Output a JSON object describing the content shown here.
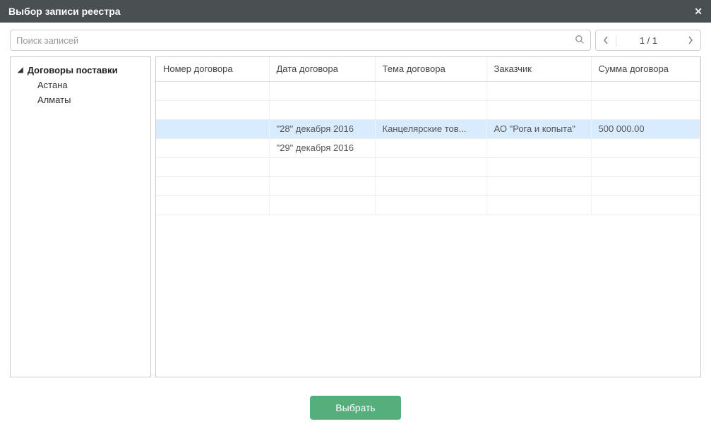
{
  "dialog": {
    "title": "Выбор записи реестра"
  },
  "search": {
    "placeholder": "Поиск записей"
  },
  "pagination": {
    "display": "1 / 1"
  },
  "sidebar": {
    "root": "Договоры поставки",
    "children": [
      "Астана",
      "Алматы"
    ]
  },
  "columns": [
    "Номер договора",
    "Дата договора",
    "Тема договора",
    "Заказчик",
    "Сумма договора"
  ],
  "rows": [
    {
      "number": "",
      "date": "",
      "topic": "",
      "customer": "",
      "amount": "",
      "selected": false
    },
    {
      "number": "",
      "date": "",
      "topic": "",
      "customer": "",
      "amount": "",
      "selected": false
    },
    {
      "number": "",
      "date": "\"28\" декабря 2016",
      "topic": "Канцелярские тов...",
      "customer": "АО \"Рога и копыта\"",
      "amount": "500 000.00",
      "selected": true
    },
    {
      "number": "",
      "date": "\"29\" декабря 2016",
      "topic": "",
      "customer": "",
      "amount": "",
      "selected": false
    },
    {
      "number": "",
      "date": "",
      "topic": "",
      "customer": "",
      "amount": "",
      "selected": false
    },
    {
      "number": "",
      "date": "",
      "topic": "",
      "customer": "",
      "amount": "",
      "selected": false
    },
    {
      "number": "",
      "date": "",
      "topic": "",
      "customer": "",
      "amount": "",
      "selected": false
    }
  ],
  "footer": {
    "select_label": "Выбрать"
  }
}
